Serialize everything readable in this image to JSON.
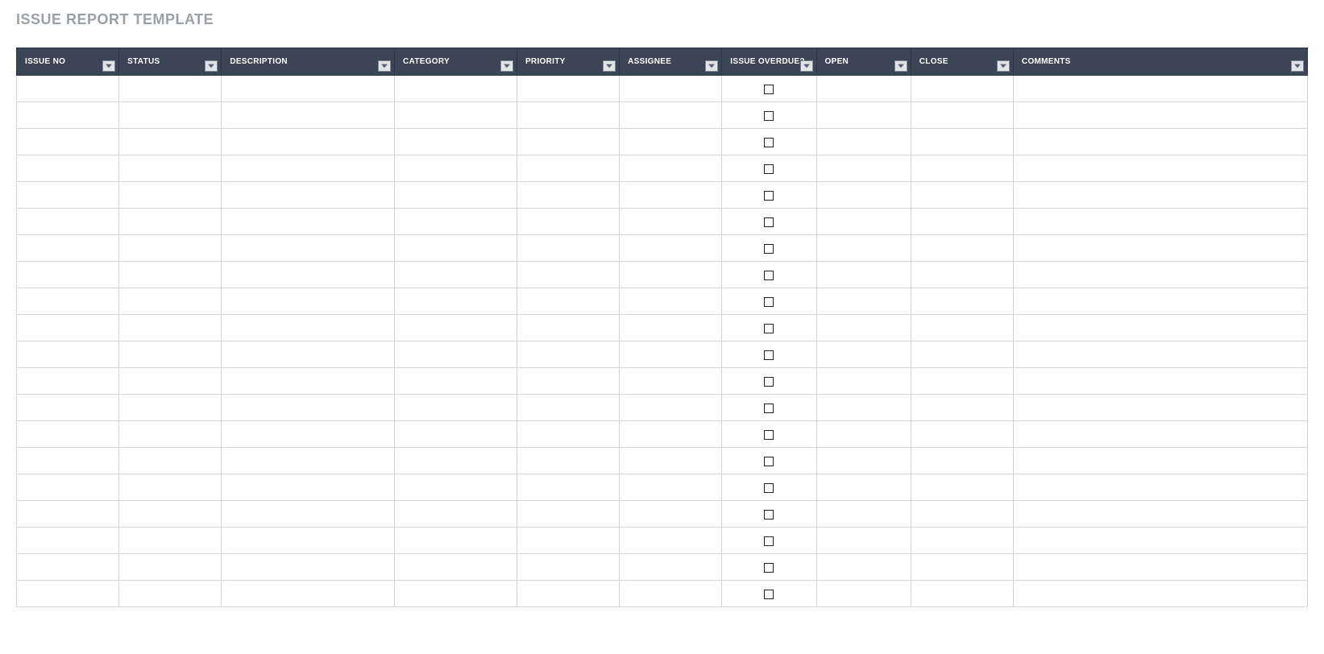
{
  "title": "ISSUE REPORT TEMPLATE",
  "columns": [
    {
      "key": "issue_no",
      "label": "ISSUE NO"
    },
    {
      "key": "status",
      "label": "STATUS"
    },
    {
      "key": "description",
      "label": "DESCRIPTION"
    },
    {
      "key": "category",
      "label": "CATEGORY"
    },
    {
      "key": "priority",
      "label": "PRIORITY"
    },
    {
      "key": "assignee",
      "label": "ASSIGNEE"
    },
    {
      "key": "overdue",
      "label": "ISSUE OVERDUE?"
    },
    {
      "key": "open",
      "label": "OPEN"
    },
    {
      "key": "close",
      "label": "CLOSE"
    },
    {
      "key": "comments",
      "label": "COMMENTS"
    }
  ],
  "rows": [
    {
      "issue_no": "",
      "status": "",
      "description": "",
      "category": "",
      "priority": "",
      "assignee": "",
      "overdue": false,
      "open": "",
      "close": "",
      "comments": ""
    },
    {
      "issue_no": "",
      "status": "",
      "description": "",
      "category": "",
      "priority": "",
      "assignee": "",
      "overdue": false,
      "open": "",
      "close": "",
      "comments": ""
    },
    {
      "issue_no": "",
      "status": "",
      "description": "",
      "category": "",
      "priority": "",
      "assignee": "",
      "overdue": false,
      "open": "",
      "close": "",
      "comments": ""
    },
    {
      "issue_no": "",
      "status": "",
      "description": "",
      "category": "",
      "priority": "",
      "assignee": "",
      "overdue": false,
      "open": "",
      "close": "",
      "comments": ""
    },
    {
      "issue_no": "",
      "status": "",
      "description": "",
      "category": "",
      "priority": "",
      "assignee": "",
      "overdue": false,
      "open": "",
      "close": "",
      "comments": ""
    },
    {
      "issue_no": "",
      "status": "",
      "description": "",
      "category": "",
      "priority": "",
      "assignee": "",
      "overdue": false,
      "open": "",
      "close": "",
      "comments": ""
    },
    {
      "issue_no": "",
      "status": "",
      "description": "",
      "category": "",
      "priority": "",
      "assignee": "",
      "overdue": false,
      "open": "",
      "close": "",
      "comments": ""
    },
    {
      "issue_no": "",
      "status": "",
      "description": "",
      "category": "",
      "priority": "",
      "assignee": "",
      "overdue": false,
      "open": "",
      "close": "",
      "comments": ""
    },
    {
      "issue_no": "",
      "status": "",
      "description": "",
      "category": "",
      "priority": "",
      "assignee": "",
      "overdue": false,
      "open": "",
      "close": "",
      "comments": ""
    },
    {
      "issue_no": "",
      "status": "",
      "description": "",
      "category": "",
      "priority": "",
      "assignee": "",
      "overdue": false,
      "open": "",
      "close": "",
      "comments": ""
    },
    {
      "issue_no": "",
      "status": "",
      "description": "",
      "category": "",
      "priority": "",
      "assignee": "",
      "overdue": false,
      "open": "",
      "close": "",
      "comments": ""
    },
    {
      "issue_no": "",
      "status": "",
      "description": "",
      "category": "",
      "priority": "",
      "assignee": "",
      "overdue": false,
      "open": "",
      "close": "",
      "comments": ""
    },
    {
      "issue_no": "",
      "status": "",
      "description": "",
      "category": "",
      "priority": "",
      "assignee": "",
      "overdue": false,
      "open": "",
      "close": "",
      "comments": ""
    },
    {
      "issue_no": "",
      "status": "",
      "description": "",
      "category": "",
      "priority": "",
      "assignee": "",
      "overdue": false,
      "open": "",
      "close": "",
      "comments": ""
    },
    {
      "issue_no": "",
      "status": "",
      "description": "",
      "category": "",
      "priority": "",
      "assignee": "",
      "overdue": false,
      "open": "",
      "close": "",
      "comments": ""
    },
    {
      "issue_no": "",
      "status": "",
      "description": "",
      "category": "",
      "priority": "",
      "assignee": "",
      "overdue": false,
      "open": "",
      "close": "",
      "comments": ""
    },
    {
      "issue_no": "",
      "status": "",
      "description": "",
      "category": "",
      "priority": "",
      "assignee": "",
      "overdue": false,
      "open": "",
      "close": "",
      "comments": ""
    },
    {
      "issue_no": "",
      "status": "",
      "description": "",
      "category": "",
      "priority": "",
      "assignee": "",
      "overdue": false,
      "open": "",
      "close": "",
      "comments": ""
    },
    {
      "issue_no": "",
      "status": "",
      "description": "",
      "category": "",
      "priority": "",
      "assignee": "",
      "overdue": false,
      "open": "",
      "close": "",
      "comments": ""
    },
    {
      "issue_no": "",
      "status": "",
      "description": "",
      "category": "",
      "priority": "",
      "assignee": "",
      "overdue": false,
      "open": "",
      "close": "",
      "comments": ""
    }
  ],
  "colors": {
    "header_bg": "#3b4556",
    "header_text": "#ffffff",
    "title_text": "#9aa0a6",
    "border": "#d6d6d6"
  }
}
